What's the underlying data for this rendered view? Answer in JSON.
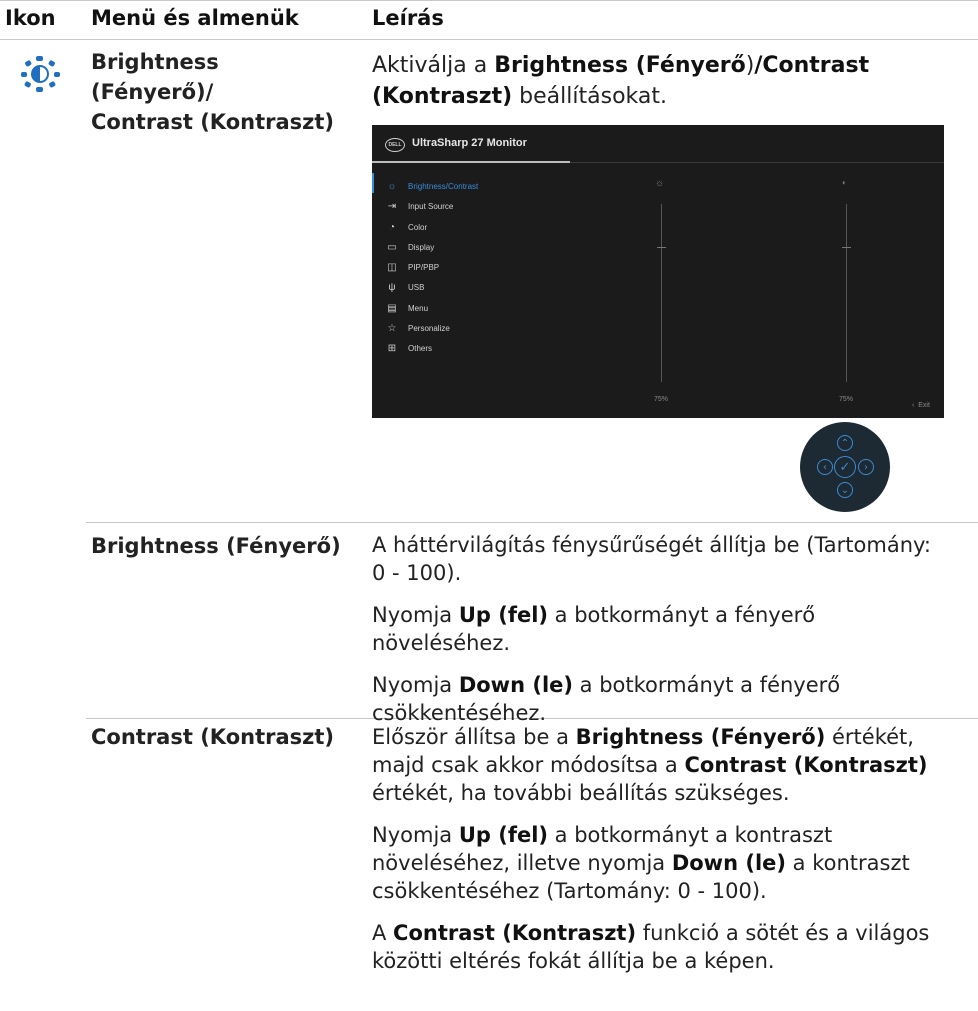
{
  "table": {
    "headers": {
      "icon": "Ikon",
      "menu": "Menü és almenük",
      "description": "Leírás"
    }
  },
  "icon": {
    "name": "brightness-contrast-icon",
    "color": "#1f6fc0"
  },
  "rows": {
    "main": {
      "menu_line1": "Brightness",
      "menu_line2": "(Fényerő)/",
      "menu_line3": "Contrast (Kontraszt)",
      "desc_prefix": "Aktiválja a ",
      "desc_bold1": "Brightness (Fényerő",
      "desc_mid": ")",
      "desc_bold2": "/Contrast",
      "desc_bold3": "(Kontraszt)",
      "desc_suffix": " beállításokat."
    },
    "brightness": {
      "label": "Brightness (Fényerő)",
      "p1_line1": "A háttérvilágítás fénysűrűségét állítja be (Tartomány:",
      "p1_line2": "0 - 100).",
      "p2_pre": "Nyomja ",
      "p2_bold": "Up (fel)",
      "p2_post": " a botkormányt a fényerő",
      "p2_line2": "növeléséhez.",
      "p3_pre": "Nyomja ",
      "p3_bold": "Down (le)",
      "p3_post": " a botkormányt a fényerő",
      "p3_line2": "csökkentéséhez."
    },
    "contrast": {
      "label": "Contrast (Kontraszt)",
      "p1_pre": "Először állítsa be a ",
      "p1_bold": "Brightness (Fényerő)",
      "p1_post": " értékét,",
      "p1_l2_pre": "majd csak akkor módosítsa a ",
      "p1_l2_bold": "Contrast (Kontraszt)",
      "p1_line3": "értékét, ha további beállítás szükséges.",
      "p2_pre": "Nyomja ",
      "p2_bold": "Up (fel)",
      "p2_post": " a botkormányt a kontraszt",
      "p2_l2_pre": "növeléséhez, illetve nyomja ",
      "p2_l2_bold": "Down (le)",
      "p2_l2_post": " a kontraszt",
      "p2_line3": "csökkentéséhez (Tartomány: 0 - 100).",
      "p3_pre": "A ",
      "p3_bold": "Contrast (Kontraszt)",
      "p3_post": " funkció a sötét és a világos",
      "p3_line2": "közötti eltérés fokát állítja be a képen."
    }
  },
  "osd": {
    "logo": "DELL",
    "title": "UltraSharp 27 Monitor",
    "menu": [
      {
        "label": "Brightness/Contrast",
        "icon": "sun-icon",
        "active": true
      },
      {
        "label": "Input Source",
        "icon": "input-icon",
        "active": false
      },
      {
        "label": "Color",
        "icon": "palette-icon",
        "active": false
      },
      {
        "label": "Display",
        "icon": "monitor-icon",
        "active": false
      },
      {
        "label": "PIP/PBP",
        "icon": "pip-icon",
        "active": false
      },
      {
        "label": "USB",
        "icon": "usb-icon",
        "active": false
      },
      {
        "label": "Menu",
        "icon": "menu-icon",
        "active": false
      },
      {
        "label": "Personalize",
        "icon": "star-icon",
        "active": false
      },
      {
        "label": "Others",
        "icon": "others-icon",
        "active": false
      }
    ],
    "brightness_value": "75%",
    "contrast_value": "75%",
    "brightness_level": 75,
    "contrast_level": 75,
    "exit_label": "Exit",
    "active_color": "#3b8bd6"
  },
  "joystick": {
    "up": "up-arrow-icon",
    "down": "down-arrow-icon",
    "left": "left-arrow-icon",
    "right": "right-arrow-icon",
    "center": "check-icon"
  }
}
